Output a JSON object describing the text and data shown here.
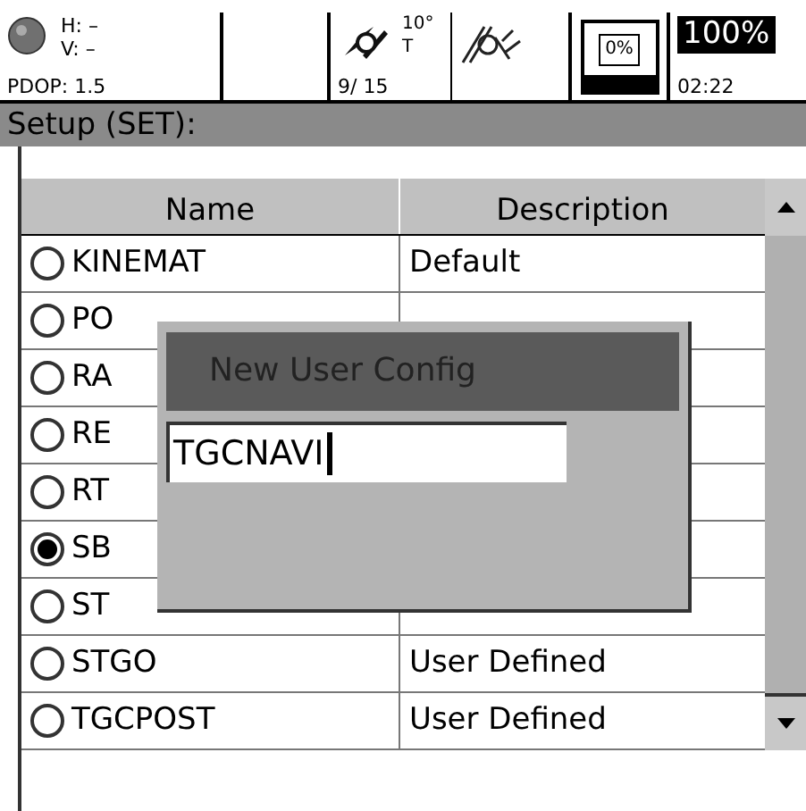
{
  "status_bar": {
    "h": "H: –",
    "v": "V: –",
    "pdop": "PDOP: 1.5",
    "elevation": "10°",
    "elevation_unit": "T",
    "satellites": "9/ 15",
    "memory": "0%",
    "battery": "100%",
    "time": "02:22"
  },
  "title": "Setup (SET):",
  "table": {
    "columns": [
      "Name",
      "Description"
    ],
    "rows": [
      {
        "name": "KINEMAT",
        "description": "Default",
        "selected": false
      },
      {
        "name": "PO",
        "selected": false
      },
      {
        "name": "RA",
        "selected": false
      },
      {
        "name": "RE",
        "selected": false
      },
      {
        "name": "RT",
        "selected": false
      },
      {
        "name": "SB",
        "selected": true
      },
      {
        "name": "ST",
        "selected": false
      },
      {
        "name": "STGO",
        "description": "User Defined",
        "selected": false
      },
      {
        "name": "TGCPOST",
        "description": "User Defined",
        "selected": false
      }
    ]
  },
  "dialog": {
    "title": "New User Config",
    "value": "TGCNAVI"
  }
}
